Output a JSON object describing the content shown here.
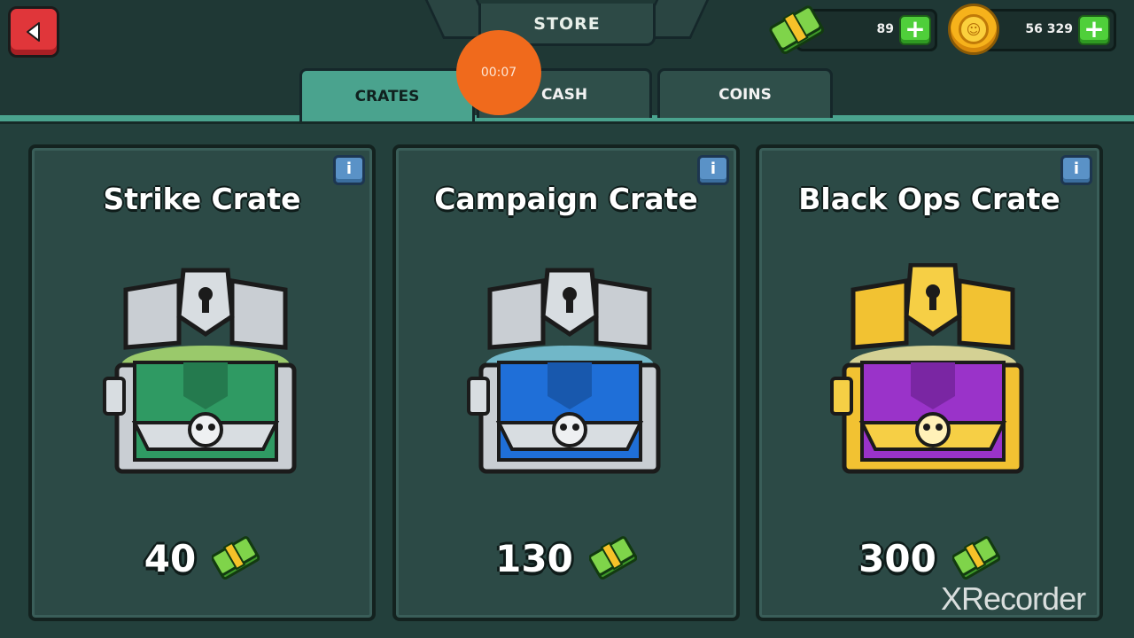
{
  "header": {
    "title": "STORE",
    "cash_balance": "89",
    "coin_balance": "56 329",
    "plus_label": "+"
  },
  "tabs": [
    {
      "label": "CRATES",
      "active": true
    },
    {
      "label": "CASH",
      "active": false
    },
    {
      "label": "COINS",
      "active": false
    }
  ],
  "recorder": {
    "timer": "00:07",
    "watermark": "XRecorder"
  },
  "crates": [
    {
      "name": "Strike Crate",
      "price": "40",
      "color": "#2f9a63"
    },
    {
      "name": "Campaign Crate",
      "price": "130",
      "color": "#1f6fd8"
    },
    {
      "name": "Black Ops Crate",
      "price": "300",
      "color": "#9a33c9"
    }
  ],
  "info_label": "i",
  "icons": {
    "back": "back-arrow-icon",
    "cash": "cash-bundle-icon",
    "coin": "coin-icon",
    "info": "info-icon"
  }
}
